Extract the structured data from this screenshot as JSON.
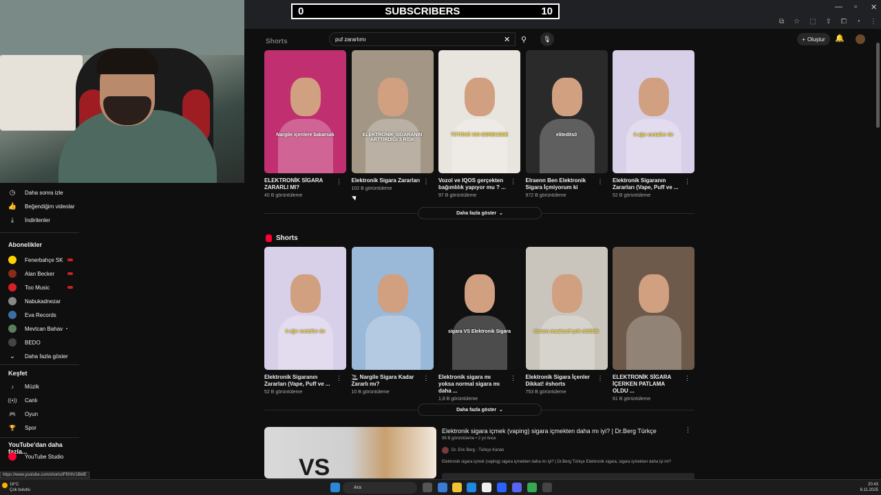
{
  "overlay": {
    "left_count": "0",
    "label": "SUBSCRIBERS",
    "right_count": "10"
  },
  "search": {
    "value": "puf zararlımı"
  },
  "header": {
    "create_label": "Oluştur"
  },
  "sidebar": {
    "library": [
      {
        "icon": "clock-icon",
        "glyph": "◷",
        "label": "Daha sonra izle"
      },
      {
        "icon": "thumbs-up-icon",
        "glyph": "👍",
        "label": "Beğendiğim videolar"
      },
      {
        "icon": "download-icon",
        "glyph": "⤓",
        "label": "İndirilenler"
      }
    ],
    "subscriptions_title": "Abonelikler",
    "subscriptions": [
      {
        "label": "Fenerbahçe SK",
        "color": "#ffd200",
        "live": true
      },
      {
        "label": "Alan Becker",
        "color": "#8b2a1a",
        "live": true
      },
      {
        "label": "Too Music",
        "color": "#d61f26",
        "live": true
      },
      {
        "label": "Nabukadnezar",
        "color": "#888888",
        "live": false
      },
      {
        "label": "Eva Records",
        "color": "#3a6ea5",
        "live": false
      },
      {
        "label": "Mevtcan Bahav",
        "color": "#5a7f5a",
        "live": false,
        "dot": true
      },
      {
        "label": "BEDO",
        "color": "#444444",
        "live": false
      }
    ],
    "show_more": "Daha fazla göster",
    "explore_title": "Keşfet",
    "explore": [
      {
        "icon": "music-icon",
        "glyph": "♪",
        "label": "Müzik"
      },
      {
        "icon": "live-icon",
        "glyph": "((•))",
        "label": "Canlı"
      },
      {
        "icon": "gaming-icon",
        "glyph": "🎮",
        "label": "Oyun"
      },
      {
        "icon": "trophy-icon",
        "glyph": "🏆",
        "label": "Spor"
      }
    ],
    "more_title": "YouTube'dan daha fazla...",
    "studio": "YouTube Studio"
  },
  "shorts_top_title": "Shorts",
  "shorts_row1": [
    {
      "title": "ELEKTRONİK SİGARA ZARARLI MI?",
      "views": "40 B görüntüleme",
      "bg": "#c03070",
      "caption": "Nargile içenlere bakarsak",
      "cap_yellow": false
    },
    {
      "title": "Elektronik Sigara Zararları",
      "views": "102 B görüntüleme",
      "bg": "#a39685",
      "caption": "ELEKTRONİK SİGARANIN ARTTIRDIĞI 3 RİSK",
      "cap_yellow": false
    },
    {
      "title": "Vozol ve IQOS gerçekten bağımlılık yapıyor mu ? ...",
      "views": "97 B görüntüleme",
      "bg": "#e8e4de",
      "caption": "TÜTÜNÜ 350 DERECEDE",
      "cap_yellow": true
    },
    {
      "title": "Elraenn Ben Elektronik Sigara İçmiyorum ki",
      "views": "972 B görüntüleme",
      "bg": "#2a2a2a",
      "caption": "elitedits0",
      "cap_yellow": false
    },
    {
      "title": "Elektronik Sigaranın Zararları (Vape, Puff ve ...",
      "views": "52 B görüntüleme",
      "bg": "#d8d0e8",
      "caption": "6 ağır metaller de",
      "cap_yellow": true
    }
  ],
  "show_more_label": "Daha fazla göster",
  "shorts_title": "Shorts",
  "shorts_row2": [
    {
      "title": "Elektronik Sigaranın Zararları (Vape, Puff ve ...",
      "views": "52 B görüntüleme",
      "bg": "#d8d0e8",
      "caption": "6 ağır metaller de",
      "cap_yellow": true
    },
    {
      "title": "🚬 Nargile Sigara Kadar Zararlı mı?",
      "views": "10 B görüntüleme",
      "bg": "#9ab8d8",
      "caption": "",
      "cap_yellow": false
    },
    {
      "title": "Elektronik sigara mı yoksa normal sigara mı daha ...",
      "views": "1,8 B görüntüleme",
      "bg": "#111111",
      "caption": "sigara VS Elektronik Sigara",
      "cap_yellow": false
    },
    {
      "title": "Elektronik Sigara İçenler Dikkat! #shorts",
      "views": "753 B görüntüleme",
      "bg": "#c9c4bc",
      "caption": "durum maalesef çok ciddidir",
      "cap_yellow": true
    },
    {
      "title": "ELEKTRONİK SİGARA İÇERKEN PATLAMA OLDU ...",
      "views": "61 B görüntüleme",
      "bg": "#6e5a4a",
      "caption": "",
      "cap_yellow": false
    }
  ],
  "video": {
    "title": "Elektronik sigara içmek (vaping) sigara içmekten daha mı iyi? | Dr.Berg Türkçe",
    "meta": "98 B görüntüleme • 2 yıl önce",
    "channel": "Dr. Eric Berg - Türkçe Kanalı",
    "desc": "Elektronik sigara içmek (vaping) sigara içmekten daha mı iyi? | Dr.Berg Türkçe Elektronik sigara, sigara içmekten daha iyi mi?",
    "thumb_text": "VS"
  },
  "status_url": "https://www.youtube.com/shorts/iFf00tV1BME",
  "taskbar": {
    "temp": "16°C",
    "weather": "Çok bulutlu",
    "search": "Ara",
    "time": "20:43",
    "date": "6.11.2025"
  }
}
